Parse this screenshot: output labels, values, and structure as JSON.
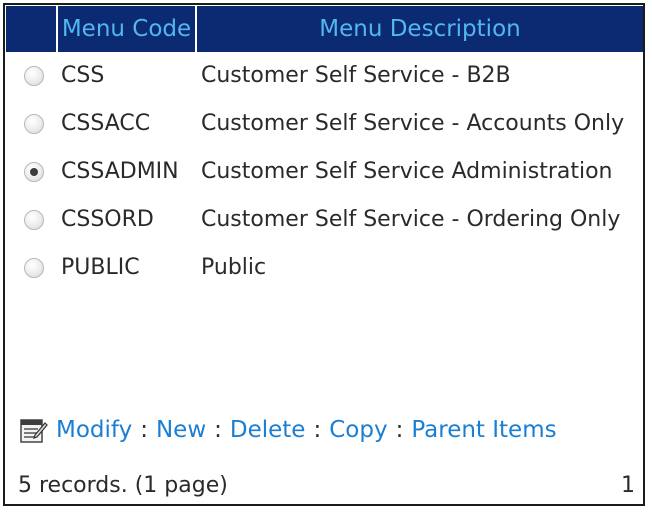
{
  "header": {
    "select_label": "",
    "code_label": "Menu Code",
    "description_label": "Menu Description"
  },
  "rows": [
    {
      "code": "CSS",
      "description": "Customer Self Service - B2B",
      "selected": false
    },
    {
      "code": "CSSACC",
      "description": "Customer Self Service - Accounts Only",
      "selected": false
    },
    {
      "code": "CSSADMIN",
      "description": "Customer Self Service Administration",
      "selected": true
    },
    {
      "code": "CSSORD",
      "description": "Customer Self Service - Ordering Only",
      "selected": false
    },
    {
      "code": "PUBLIC",
      "description": "Public",
      "selected": false
    }
  ],
  "actions": {
    "icon": "edit-form-icon",
    "modify": "Modify",
    "new": "New",
    "delete": "Delete",
    "copy": "Copy",
    "parent_items": "Parent Items",
    "separator": ":"
  },
  "footer": {
    "records_text": "5 records. (1 page)",
    "page_number": "1"
  },
  "colors": {
    "header_bg": "#0b2a72",
    "header_text": "#52b6f0",
    "link": "#1a7fd3",
    "text": "#2a2a2a"
  }
}
